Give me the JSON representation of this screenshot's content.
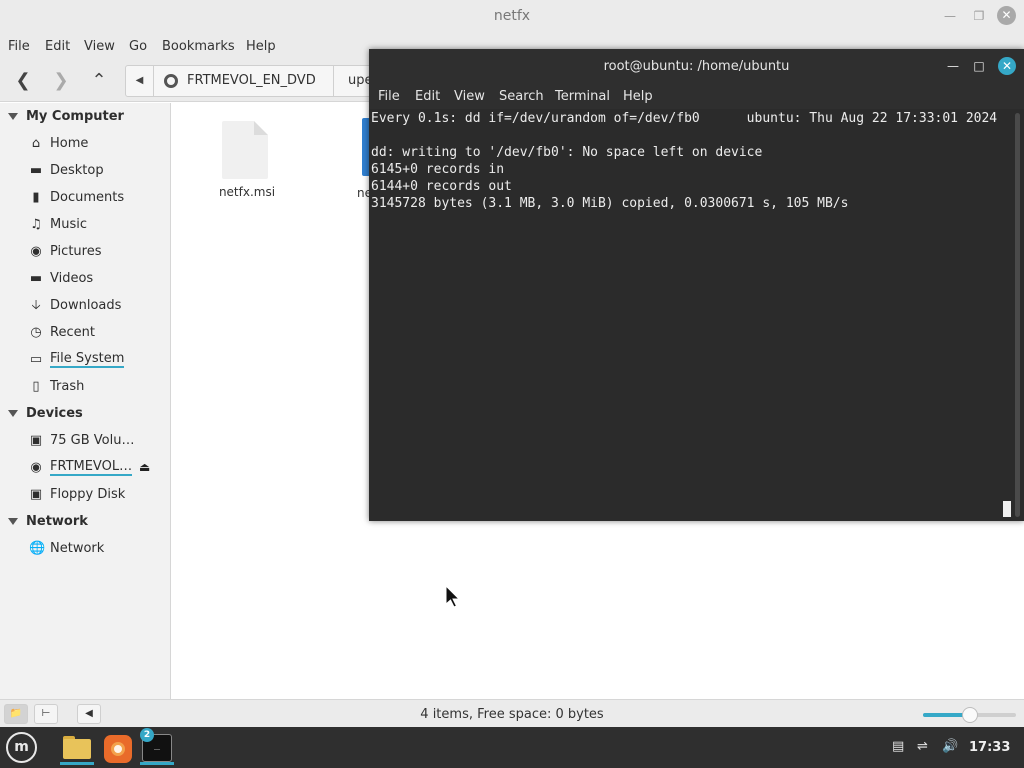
{
  "file_manager": {
    "title": "netfx",
    "menu": [
      "File",
      "Edit",
      "View",
      "Go",
      "Bookmarks",
      "Help"
    ],
    "path": {
      "crumb": "FRTMEVOL_EN_DVD",
      "next_crumb": "upe"
    },
    "sidebar": {
      "my_computer": {
        "heading": "My Computer",
        "items": [
          {
            "label": "Home",
            "icon": "home-icon"
          },
          {
            "label": "Desktop",
            "icon": "desktop-icon"
          },
          {
            "label": "Documents",
            "icon": "documents-icon"
          },
          {
            "label": "Music",
            "icon": "music-icon"
          },
          {
            "label": "Pictures",
            "icon": "camera-icon"
          },
          {
            "label": "Videos",
            "icon": "video-folder-icon"
          },
          {
            "label": "Downloads",
            "icon": "download-icon"
          },
          {
            "label": "Recent",
            "icon": "clock-icon"
          },
          {
            "label": "File System",
            "icon": "drive-icon"
          },
          {
            "label": "Trash",
            "icon": "trash-icon"
          }
        ]
      },
      "devices": {
        "heading": "Devices",
        "items": [
          {
            "label": "75 GB Volu…",
            "icon": "chip-icon"
          },
          {
            "label": "FRTMEVOL…",
            "icon": "disc-icon"
          },
          {
            "label": "Floppy Disk",
            "icon": "floppy-icon"
          }
        ]
      },
      "network": {
        "heading": "Network",
        "items": [
          {
            "label": "Network",
            "icon": "globe-icon"
          }
        ]
      }
    },
    "files": [
      {
        "name": "netfx.msi"
      },
      {
        "name": "ne"
      }
    ],
    "status": "4 items, Free space: 0 bytes",
    "zoom_fraction": 0.5
  },
  "terminal": {
    "title": "root@ubuntu: /home/ubuntu",
    "menu": [
      "File",
      "Edit",
      "View",
      "Search",
      "Terminal",
      "Help"
    ],
    "lines": [
      "Every 0.1s: dd if=/dev/urandom of=/dev/fb0      ubuntu: Thu Aug 22 17:33:01 2024",
      "",
      "dd: writing to '/dev/fb0': No space left on device",
      "6145+0 records in",
      "6144+0 records out",
      "3145728 bytes (3.1 MB, 3.0 MiB) copied, 0.0300671 s, 105 MB/s"
    ]
  },
  "taskbar": {
    "terminal_badge": "2",
    "clock": "17:33"
  },
  "colors": {
    "accent": "#35a8c7",
    "terminal_bg": "#2b2b2b",
    "panel_bg": "#2f2f2f"
  }
}
